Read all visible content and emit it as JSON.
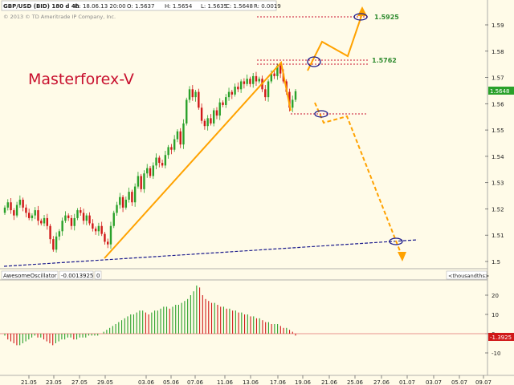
{
  "header": {
    "symbol": "GBP/USD (BID) 180 d 4h",
    "date": "D: 18.06.13 20:00",
    "open": "O: 1.5637",
    "high": "H: 1.5654",
    "low": "L: 1.5635",
    "close": "C: 1.5648",
    "range": "R: 0.0019",
    "copyright": "© 2013 © TD Ameritrade IP Company, Inc."
  },
  "watermark": "Masterforex-V",
  "oscillator_header": {
    "name": "AwesomeOscillator",
    "value": "-0.0013925",
    "flag": "0",
    "units": "<thousandths>"
  },
  "colors": {
    "background": "#fffbe8",
    "bull_candle": "#2aa12a",
    "bear_candle": "#d01818",
    "annotation": "#ffa200",
    "trendline": "#1a1a8c",
    "level_line": "#c8102e",
    "level_text": "#2e8b2e",
    "watermark": "#c8102e"
  },
  "chart_data": [
    {
      "type": "candlestick",
      "title": "GBP/USD (BID) 180 d 4h",
      "y_ticks": [
        "1.5",
        "1.51",
        "1.52",
        "1.53",
        "1.54",
        "1.55",
        "1.56",
        "1.57",
        "1.58",
        "1.59"
      ],
      "ylim": [
        1.497,
        1.6
      ],
      "x_tick_labels": [
        "21.05",
        "23.05",
        "27.05",
        "29.05",
        "03.06",
        "05.06",
        "07.06",
        "11.06",
        "13.06",
        "17.06",
        "19.06",
        "21.06",
        "25.06",
        "27.06",
        "01.07",
        "03.07",
        "05.07",
        "09.07"
      ],
      "last_price_label": "1.5648",
      "key_levels": [
        {
          "label": "1.5925",
          "value": 1.5925
        },
        {
          "label": "1.5762",
          "value": 1.5762
        }
      ],
      "candles_close": [
        1.5205,
        1.5225,
        1.5195,
        1.5175,
        1.5215,
        1.5235,
        1.5205,
        1.5185,
        1.5165,
        1.5175,
        1.5195,
        1.5155,
        1.5145,
        1.5165,
        1.5135,
        1.5085,
        1.5045,
        1.5095,
        1.5115,
        1.5155,
        1.5175,
        1.5165,
        1.5135,
        1.5165,
        1.5195,
        1.5185,
        1.5155,
        1.5175,
        1.5145,
        1.5125,
        1.5115,
        1.5135,
        1.5105,
        1.5075,
        1.5065,
        1.5135,
        1.5185,
        1.5215,
        1.5245,
        1.5205,
        1.5235,
        1.5265,
        1.5225,
        1.5285,
        1.5325,
        1.5275,
        1.5335,
        1.5355,
        1.5325,
        1.5365,
        1.5395,
        1.5375,
        1.5365,
        1.5405,
        1.5435,
        1.5425,
        1.5465,
        1.5495,
        1.5445,
        1.5525,
        1.5615,
        1.5655,
        1.5625,
        1.5645,
        1.5585,
        1.5535,
        1.5515,
        1.5545,
        1.5525,
        1.5575,
        1.5555,
        1.5605,
        1.5595,
        1.5625,
        1.5645,
        1.5635,
        1.5665,
        1.5655,
        1.5685,
        1.5675,
        1.5695,
        1.5675,
        1.5705,
        1.5685,
        1.5695,
        1.5655,
        1.5625,
        1.5685,
        1.5715,
        1.5705,
        1.5745,
        1.5715,
        1.5685,
        1.5645,
        1.5585,
        1.5615,
        1.5648
      ]
    },
    {
      "type": "bar",
      "title": "AwesomeOscillator",
      "y_ticks": [
        "-10",
        "0",
        "10",
        "20"
      ],
      "ylim": [
        -14,
        29
      ],
      "current_value_label": "-1.3925",
      "values": [
        -1,
        -3,
        -4,
        -5,
        -6,
        -6,
        -5,
        -4,
        -3,
        -2,
        -1,
        -2,
        -2,
        -3,
        -4,
        -5,
        -6,
        -5,
        -4,
        -3,
        -3,
        -2,
        -2,
        -3,
        -3,
        -2,
        -2,
        -2,
        -1,
        -1,
        -1,
        -1,
        0,
        1,
        2,
        3,
        4,
        5,
        6,
        7,
        8,
        9,
        10,
        10,
        11,
        12,
        12,
        11,
        10,
        11,
        12,
        12,
        13,
        14,
        14,
        13,
        14,
        15,
        15,
        16,
        17,
        18,
        20,
        22,
        25,
        24,
        20,
        18,
        17,
        16,
        16,
        15,
        14,
        14,
        13,
        13,
        12,
        12,
        11,
        11,
        10,
        10,
        9,
        9,
        8,
        8,
        7,
        6,
        6,
        5,
        5,
        5,
        4,
        3,
        3,
        2,
        1,
        -1
      ]
    }
  ]
}
